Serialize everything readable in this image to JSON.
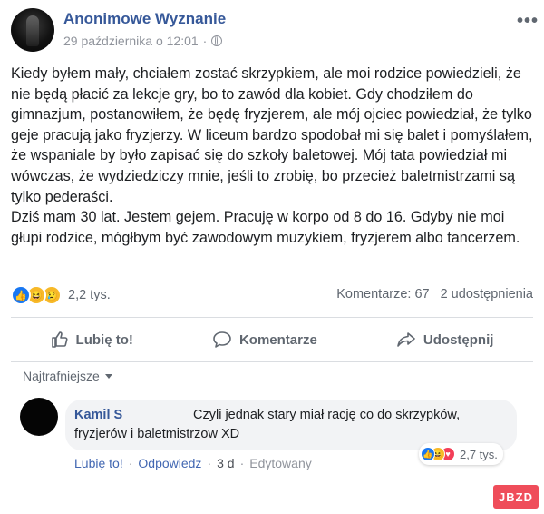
{
  "post": {
    "author": "Anonimowe Wyznanie",
    "date": "29 października o 12:01",
    "privacy_icon": "globe-icon",
    "paragraphs": [
      "Kiedy byłem mały, chciałem zostać skrzypkiem, ale moi rodzice powiedzieli, że nie będą płacić za lekcje gry, bo to zawód dla kobiet. Gdy chodziłem do gimnazjum, postanowiłem, że będę fryzjerem, ale mój ojciec powiedział, że tylko geje pracują jako fryzjerzy. W liceum bardzo spodobał mi się balet i pomyślałem, że wspaniale by było zapisać się do szkoły baletowej. Mój tata powiedział mi wówczas, że wydziedziczy mnie, jeśli to zrobię, bo przecież baletmistrzami są tylko pederaści.",
      "Dziś mam 30 lat. Jestem gejem. Pracuję w korpo od 8 do 16. Gdyby nie moi głupi rodzice, mógłbym być zawodowym muzykiem, fryzjerem albo tancerzem."
    ],
    "reactions": [
      "like",
      "haha",
      "sad"
    ],
    "reaction_count": "2,2 tys.",
    "comments_count": "Komentarze: 67",
    "shares_count": "2 udostępnienia"
  },
  "actions": {
    "like": "Lubię to!",
    "comment": "Komentarze",
    "share": "Udostępnij"
  },
  "comments_sort": "Najtrafniejsze",
  "comment": {
    "author": "Kamil S",
    "text_line1": "Czyli jednak stary miał rację co do skrzypków,",
    "text_line2": "fryzjerów i baletmistrzow XD",
    "reactions": [
      "like",
      "haha",
      "love"
    ],
    "reaction_count": "2,7 tys.",
    "like_link": "Lubię to!",
    "reply_link": "Odpowiedz",
    "time": "3 d",
    "edited": "Edytowany"
  },
  "watermark": "JBZD",
  "colors": {
    "link_blue": "#365899",
    "like_blue": "#1877f2",
    "haha_yellow": "#f7b928",
    "love_red": "#f33e58",
    "watermark_red": "#ef4d5a"
  }
}
